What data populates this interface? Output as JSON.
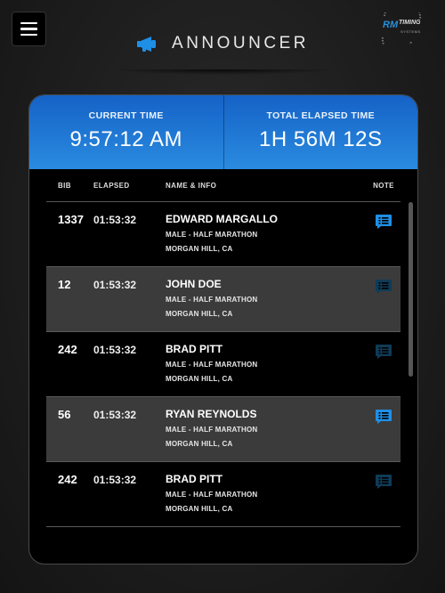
{
  "header": {
    "title": "ANNOUNCER",
    "logo_rm": "RM",
    "logo_timing": "TIMING",
    "logo_systems": "SYSTEMS",
    "accent_color": "#2a8fd8"
  },
  "times": {
    "current_label": "CURRENT TIME",
    "current_value": "9:57:12 AM",
    "elapsed_label": "TOTAL ELAPSED TIME",
    "elapsed_value": "1H 56M 12S"
  },
  "table": {
    "columns": {
      "bib": "BIB",
      "elapsed": "ELAPSED",
      "name": "NAME & INFO",
      "note": "NOTE"
    },
    "rows": [
      {
        "bib": "1337",
        "elapsed": "01:53:32",
        "name": "EDWARD MARGALLO",
        "category": "MALE - HALF MARATHON",
        "location": "MORGAN HILL, CA",
        "note_active": true
      },
      {
        "bib": "12",
        "elapsed": "01:53:32",
        "name": "JOHN DOE",
        "category": "MALE - HALF MARATHON",
        "location": "MORGAN HILL, CA",
        "note_active": false
      },
      {
        "bib": "242",
        "elapsed": "01:53:32",
        "name": "BRAD PITT",
        "category": "MALE - HALF MARATHON",
        "location": "MORGAN HILL, CA",
        "note_active": false
      },
      {
        "bib": "56",
        "elapsed": "01:53:32",
        "name": "RYAN REYNOLDS",
        "category": "MALE - HALF MARATHON",
        "location": "MORGAN HILL, CA",
        "note_active": true
      },
      {
        "bib": "242",
        "elapsed": "01:53:32",
        "name": "BRAD PITT",
        "category": "MALE - HALF MARATHON",
        "location": "MORGAN HILL, CA",
        "note_active": false
      }
    ]
  },
  "icons": {
    "menu": "hamburger-icon",
    "announcer": "megaphone-icon",
    "note": "chat-note-icon"
  },
  "colors": {
    "note_active": "#1f8fe6",
    "note_inactive": "#0f3b57"
  }
}
